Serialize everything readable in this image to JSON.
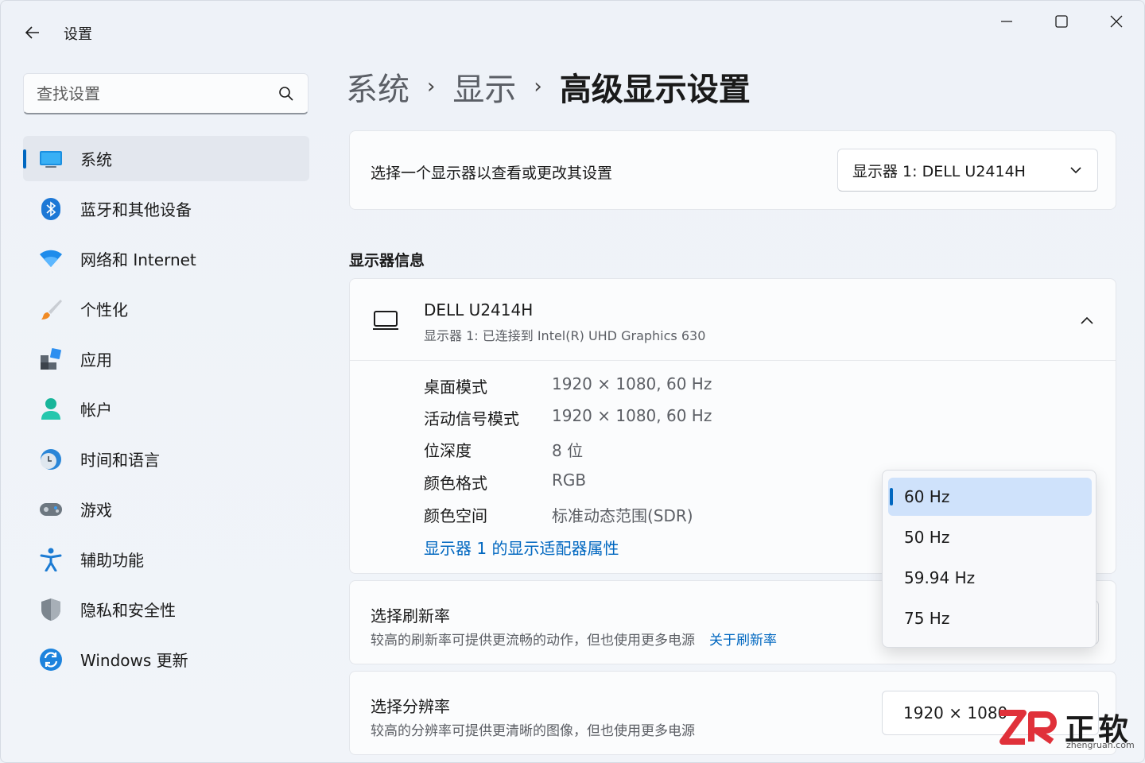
{
  "app": {
    "title": "设置"
  },
  "search": {
    "placeholder": "查找设置"
  },
  "sidebar": {
    "items": [
      {
        "label": "系统",
        "icon": "system-icon",
        "active": true
      },
      {
        "label": "蓝牙和其他设备",
        "icon": "bluetooth-icon"
      },
      {
        "label": "网络和 Internet",
        "icon": "wifi-icon"
      },
      {
        "label": "个性化",
        "icon": "brush-icon"
      },
      {
        "label": "应用",
        "icon": "apps-icon"
      },
      {
        "label": "帐户",
        "icon": "account-icon"
      },
      {
        "label": "时间和语言",
        "icon": "clock-globe-icon"
      },
      {
        "label": "游戏",
        "icon": "gamepad-icon"
      },
      {
        "label": "辅助功能",
        "icon": "accessibility-icon"
      },
      {
        "label": "隐私和安全性",
        "icon": "shield-icon"
      },
      {
        "label": "Windows 更新",
        "icon": "update-icon"
      }
    ]
  },
  "breadcrumb": {
    "items": [
      "系统",
      "显示"
    ],
    "current": "高级显示设置",
    "separator": "›"
  },
  "monitor_select": {
    "label": "选择一个显示器以查看或更改其设置",
    "value": "显示器 1:  DELL U2414H"
  },
  "section": {
    "display_info": "显示器信息"
  },
  "monitor_info": {
    "name": "DELL U2414H",
    "subtitle": "显示器 1:  已连接到 Intel(R) UHD Graphics 630",
    "rows": [
      {
        "key": "桌面模式",
        "value": "1920 × 1080, 60 Hz"
      },
      {
        "key": "活动信号模式",
        "value": "1920 × 1080, 60 Hz"
      },
      {
        "key": "位深度",
        "value": "8 位"
      },
      {
        "key": "颜色格式",
        "value": "RGB"
      },
      {
        "key": "颜色空间",
        "value": "标准动态范围(SDR)"
      }
    ],
    "adapter_link": "显示器 1 的显示适配器属性"
  },
  "refresh_rate": {
    "title": "选择刷新率",
    "desc": "较高的刷新率可提供更流畅的动作，但也使用更多电源",
    "link": "关于刷新率",
    "options": [
      "60 Hz",
      "50 Hz",
      "59.94 Hz",
      "75 Hz"
    ],
    "selected": "60 Hz"
  },
  "resolution": {
    "title": "选择分辨率",
    "desc": "较高的分辨率可提供更清晰的图像，但也使用更多电源",
    "value": "1920 × 1080"
  },
  "watermark": {
    "text": "正软",
    "sub": "zhengruan.com"
  },
  "colors": {
    "accent": "#0067c0",
    "selected_bg": "#cfe2fb",
    "watermark_red": "#e0313a"
  }
}
